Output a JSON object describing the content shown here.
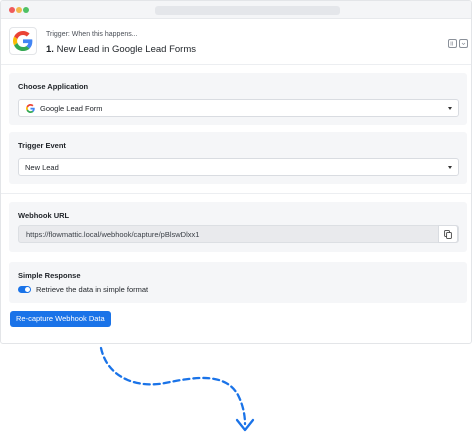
{
  "header": {
    "subtitle": "Trigger: When this happens...",
    "step_number": "1.",
    "title": "New Lead in Google Lead Forms",
    "app_icon": "google-g-logo",
    "buttons": [
      "expand-icon",
      "collapse-icon"
    ]
  },
  "choose_application": {
    "label": "Choose Application",
    "value": "Google Lead Form",
    "icon": "google-g-logo"
  },
  "trigger_event": {
    "label": "Trigger Event",
    "value": "New Lead"
  },
  "webhook": {
    "label": "Webhook URL",
    "url": "https://flowmattic.local/webhook/capture/pBlswDlxx1",
    "copy_icon": "copy-icon"
  },
  "simple_response": {
    "label": "Simple Response",
    "toggle_on": true,
    "toggle_label": "Retrieve the data in simple format"
  },
  "actions": {
    "recapture_label": "Re-capture Webhook Data"
  },
  "colors": {
    "accent": "#1a73e8",
    "connector": "#1a73e8",
    "section_bg": "#f5f6f8"
  }
}
